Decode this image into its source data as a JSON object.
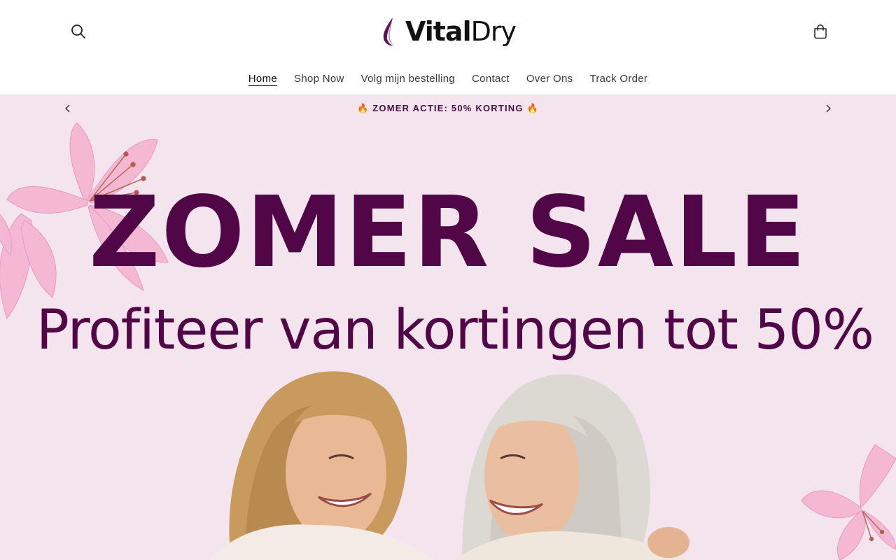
{
  "header": {
    "logo": {
      "bold": "Vital",
      "light": "Dry"
    },
    "search_icon": "search-icon",
    "cart_icon": "cart-icon"
  },
  "nav": {
    "items": [
      {
        "label": "Home",
        "active": true
      },
      {
        "label": "Shop Now",
        "active": false
      },
      {
        "label": "Volg mijn bestelling",
        "active": false
      },
      {
        "label": "Contact",
        "active": false
      },
      {
        "label": "Over Ons",
        "active": false
      },
      {
        "label": "Track Order",
        "active": false
      }
    ]
  },
  "announcement": {
    "text": "🔥 ZOMER ACTIE: 50% KORTING 🔥",
    "prev_icon": "chevron-left-icon",
    "next_icon": "chevron-right-icon"
  },
  "hero": {
    "title": "ZOMER SALE",
    "subtitle": "Profiteer van kortingen tot 50%",
    "background": "#f3e4ee",
    "text_color": "#510747"
  },
  "colors": {
    "brand": "#510747",
    "announce_bg": "#f3e4ee"
  }
}
